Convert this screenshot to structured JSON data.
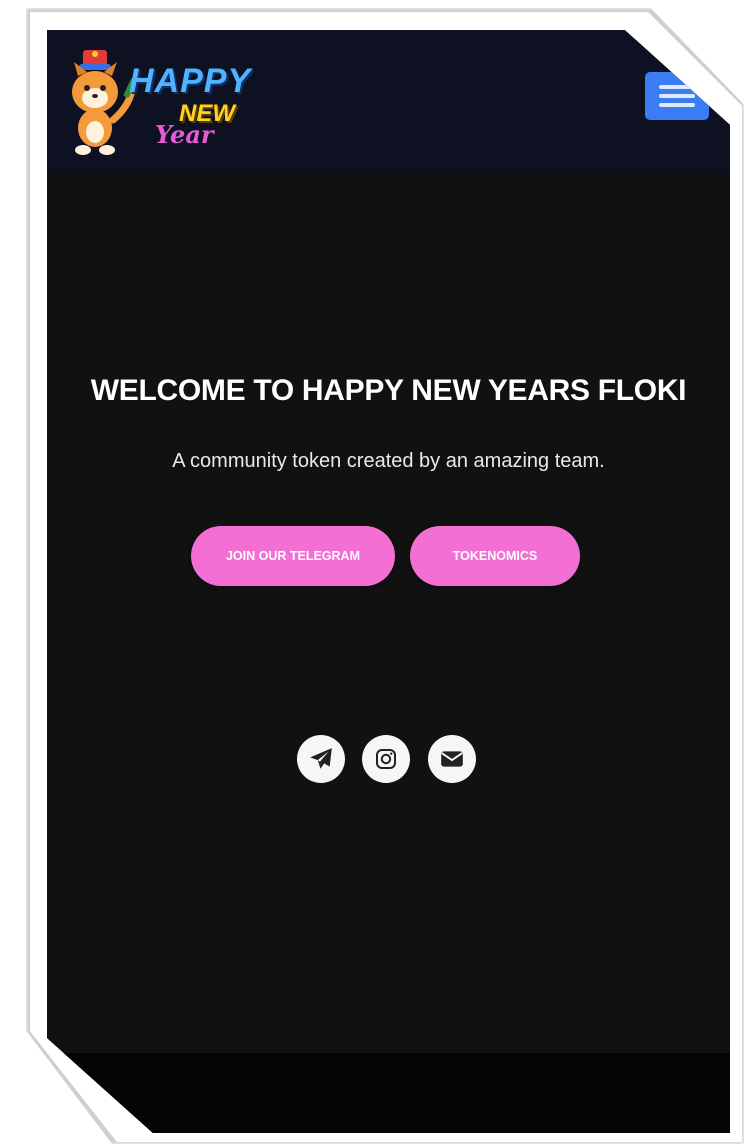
{
  "header": {
    "logo": {
      "line1": "HAPPY",
      "line2": "NEW",
      "line3": "Year"
    },
    "menu_icon": "hamburger-menu-icon"
  },
  "hero": {
    "title": "WELCOME TO HAPPY NEW YEARS FLOKI",
    "subtitle": "A community token created by an amazing team.",
    "buttons": {
      "telegram": "JOIN OUR TELEGRAM",
      "tokenomics": "TOKENOMICS"
    }
  },
  "social": [
    {
      "icon": "telegram-icon"
    },
    {
      "icon": "instagram-icon"
    },
    {
      "icon": "mail-icon"
    }
  ],
  "colors": {
    "navbar": "#0e1122",
    "page": "#111111",
    "button": "#f36fd4",
    "menu_button": "#3a7cf2",
    "logo_happy": "#4fb3ff",
    "logo_new": "#ffd21f",
    "logo_year": "#ea5ad6"
  }
}
